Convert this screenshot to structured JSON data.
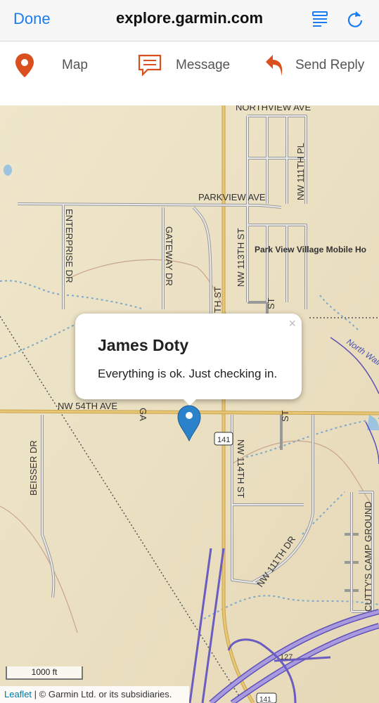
{
  "browser": {
    "done_label": "Done",
    "url": "explore.garmin.com",
    "icons": [
      "list-icon",
      "reload-icon"
    ]
  },
  "actions": [
    {
      "label": "Map",
      "icon": "map-pin-icon"
    },
    {
      "label": "Message",
      "icon": "message-icon"
    },
    {
      "label": "Send Reply",
      "icon": "reply-arrow-icon"
    }
  ],
  "colors": {
    "accent": "#1a7cf0",
    "brand_orange": "#d9501e",
    "marker": "#2a82cb",
    "map_bg": "#ece2c4"
  },
  "map": {
    "road_labels": {
      "northview": "NORTHVIEW AVE",
      "parkview": "PARKVIEW AVE",
      "enterprise": "ENTERPRISE DR",
      "gateway": "GATEWAY DR",
      "nw113": "NW 113TH ST",
      "nw111pl": "NW 111TH PL",
      "parkview_village": "Park View Village Mobile Ho",
      "th_st": "TH ST",
      "st_right": "ST",
      "north_walnut": "North Walnu",
      "nw54": "NW 54TH AVE",
      "ga": "GA",
      "hwy141": "141",
      "st_right2": "ST",
      "beisser": "BEISSER DR",
      "nw114": "NW 114TH ST",
      "nw111dr": "NW 111TH DR",
      "cuttys": "CUTTY'S CAMP GROUND",
      "hwy127": "127",
      "hwy141b": "141"
    }
  },
  "popup": {
    "close": "×",
    "name": "James Doty",
    "message": "Everything is ok. Just checking in."
  },
  "scale_label": "1000 ft",
  "attribution": {
    "leaflet": "Leaflet",
    "rest": " | © Garmin Ltd. or its subsidiaries."
  }
}
